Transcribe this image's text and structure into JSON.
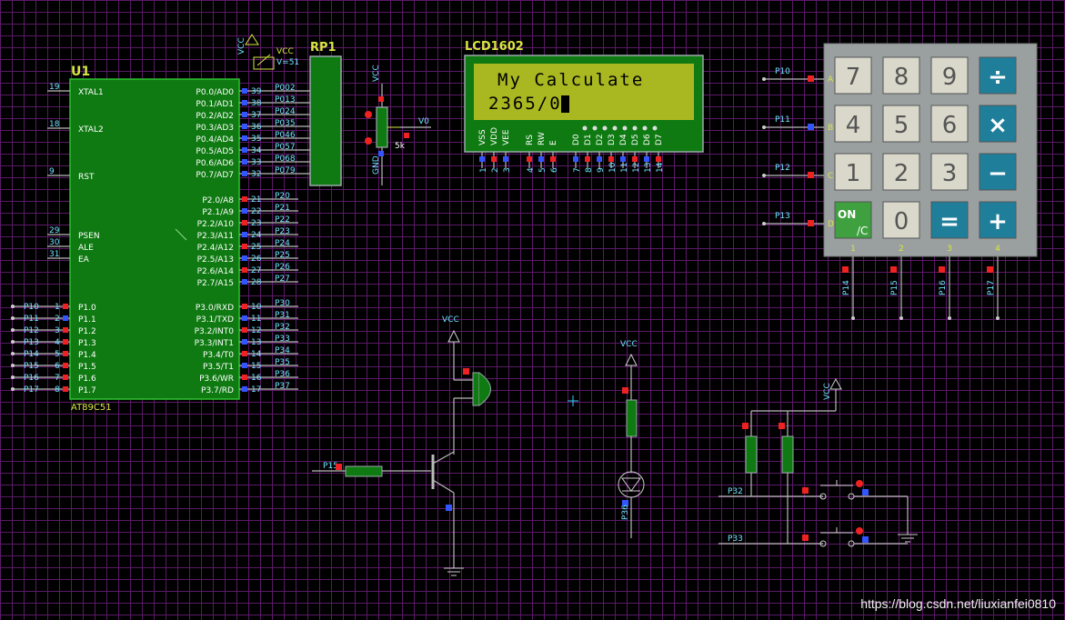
{
  "mcu": {
    "ref": "U1",
    "part": "AT89C51",
    "left_pins": [
      {
        "num": "19",
        "name": "XTAL1"
      },
      {
        "num": "18",
        "name": "XTAL2"
      },
      {
        "num": "9",
        "name": "RST"
      },
      {
        "num": "29",
        "name": "PSEN"
      },
      {
        "num": "30",
        "name": "ALE"
      },
      {
        "num": "31",
        "name": "EA"
      }
    ],
    "p1_pins": [
      {
        "net": "P10",
        "num": "1",
        "name": "P1.0"
      },
      {
        "net": "P11",
        "num": "2",
        "name": "P1.1"
      },
      {
        "net": "P12",
        "num": "3",
        "name": "P1.2"
      },
      {
        "net": "P13",
        "num": "4",
        "name": "P1.3"
      },
      {
        "net": "P14",
        "num": "5",
        "name": "P1.4"
      },
      {
        "net": "P15",
        "num": "6",
        "name": "P1.5"
      },
      {
        "net": "P16",
        "num": "7",
        "name": "P1.6"
      },
      {
        "net": "P17",
        "num": "8",
        "name": "P1.7"
      }
    ],
    "p0_pins": [
      {
        "num": "39",
        "name": "P0.0/AD0",
        "net": "P002"
      },
      {
        "num": "38",
        "name": "P0.1/AD1",
        "net": "P013"
      },
      {
        "num": "37",
        "name": "P0.2/AD2",
        "net": "P024"
      },
      {
        "num": "36",
        "name": "P0.3/AD3",
        "net": "P035"
      },
      {
        "num": "35",
        "name": "P0.4/AD4",
        "net": "P046"
      },
      {
        "num": "34",
        "name": "P0.5/AD5",
        "net": "P057"
      },
      {
        "num": "33",
        "name": "P0.6/AD6",
        "net": "P068"
      },
      {
        "num": "32",
        "name": "P0.7/AD7",
        "net": "P079"
      }
    ],
    "p2_pins": [
      {
        "num": "21",
        "name": "P2.0/A8",
        "net": "P20"
      },
      {
        "num": "22",
        "name": "P2.1/A9",
        "net": "P21"
      },
      {
        "num": "23",
        "name": "P2.2/A10",
        "net": "P22"
      },
      {
        "num": "24",
        "name": "P2.3/A11",
        "net": "P23"
      },
      {
        "num": "25",
        "name": "P2.4/A12",
        "net": "P24"
      },
      {
        "num": "26",
        "name": "P2.5/A13",
        "net": "P25"
      },
      {
        "num": "27",
        "name": "P2.6/A14",
        "net": "P26"
      },
      {
        "num": "28",
        "name": "P2.7/A15",
        "net": "P27"
      }
    ],
    "p3_pins": [
      {
        "num": "10",
        "name": "P3.0/RXD",
        "net": "P30"
      },
      {
        "num": "11",
        "name": "P3.1/TXD",
        "net": "P31"
      },
      {
        "num": "12",
        "name": "P3.2/INT0",
        "net": "P32"
      },
      {
        "num": "13",
        "name": "P3.3/INT1",
        "net": "P33"
      },
      {
        "num": "14",
        "name": "P3.4/T0",
        "net": "P34"
      },
      {
        "num": "15",
        "name": "P3.5/T1",
        "net": "P35"
      },
      {
        "num": "16",
        "name": "P3.6/WR",
        "net": "P36"
      },
      {
        "num": "17",
        "name": "P3.7/RD",
        "net": "P37"
      }
    ]
  },
  "rp1": {
    "ref": "RP1",
    "vcc": "VCC",
    "vnet": "V=51"
  },
  "pot": {
    "vcc": "VCC",
    "gnd": "GND",
    "value": "5k",
    "out": "V0"
  },
  "lcd": {
    "ref": "LCD1602",
    "line1": "My Calculate",
    "line2": "2365/0",
    "pin_names": [
      "VSS",
      "VDD",
      "VEE",
      "RS",
      "RW",
      "E",
      "D0",
      "D1",
      "D2",
      "D3",
      "D4",
      "D5",
      "D6",
      "D7"
    ],
    "pin_nums": [
      "1",
      "2",
      "3",
      "4",
      "5",
      "6",
      "7",
      "8",
      "9",
      "10",
      "11",
      "12",
      "13",
      "14"
    ]
  },
  "keypad": {
    "rows": [
      {
        "net": "P10",
        "letter": "A",
        "keys": [
          "7",
          "8",
          "9",
          "÷"
        ]
      },
      {
        "net": "P11",
        "letter": "B",
        "keys": [
          "4",
          "5",
          "6",
          "×"
        ]
      },
      {
        "net": "P12",
        "letter": "C",
        "keys": [
          "1",
          "2",
          "3",
          "−"
        ]
      },
      {
        "net": "P13",
        "letter": "D",
        "keys": [
          "ON/C",
          "0",
          "=",
          "+"
        ]
      }
    ],
    "col_nums": [
      "1",
      "2",
      "3",
      "4"
    ],
    "col_nets": [
      "P14",
      "P15",
      "P16",
      "P17"
    ]
  },
  "buzzer": {
    "vcc": "VCC",
    "base_net": "P15"
  },
  "led": {
    "vcc": "VCC",
    "net": "P36"
  },
  "buttons": {
    "vcc": "VCC",
    "nets": [
      "P32",
      "P33"
    ]
  },
  "watermark": "https://blog.csdn.net/liuxianfei0810",
  "colors": {
    "grid": "#5a1a66",
    "chip": "#0f7a12",
    "lcd_bg": "#a9b820",
    "key_gray": "#d9d8ca",
    "key_blue": "#1f7f9a",
    "label": "#d8e640",
    "pin_num": "#6fe3ff"
  }
}
